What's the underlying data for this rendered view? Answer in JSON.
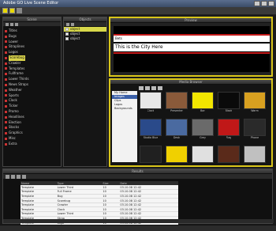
{
  "window": {
    "title": "Adobe GO Live Scene Editor"
  },
  "panels": {
    "tree_title": "Scene",
    "objects_title": "Objects",
    "preview_title": "Preview",
    "media_title": "Media Browser",
    "results_title": "Results"
  },
  "tree": {
    "items": [
      {
        "label": "Titles",
        "hl": false
      },
      {
        "label": "Bugs",
        "hl": false
      },
      {
        "label": "Lower",
        "hl": false
      },
      {
        "label": "Straplines",
        "hl": false
      },
      {
        "label": "Logos",
        "hl": false
      },
      {
        "label": "Scorebug",
        "hl": true
      },
      {
        "label": "Crawler",
        "hl": false
      },
      {
        "label": "Templates",
        "hl": false
      },
      {
        "label": "Fullframe",
        "hl": false
      },
      {
        "label": "Lower Thirds",
        "hl": false
      },
      {
        "label": "News Straps",
        "hl": false
      },
      {
        "label": "Weather",
        "hl": false
      },
      {
        "label": "Sports",
        "hl": false
      },
      {
        "label": "Clock",
        "hl": false
      },
      {
        "label": "Ticker",
        "hl": false
      },
      {
        "label": "Promo",
        "hl": false
      },
      {
        "label": "Headlines",
        "hl": false
      },
      {
        "label": "Election",
        "hl": false
      },
      {
        "label": "Stocks",
        "hl": false
      },
      {
        "label": "Graphics",
        "hl": false
      },
      {
        "label": "Misc",
        "hl": false
      },
      {
        "label": "Extra",
        "hl": false
      }
    ]
  },
  "objects": {
    "items": [
      {
        "label": "object",
        "sel": true
      },
      {
        "label": "object",
        "sel": false
      },
      {
        "label": "object",
        "sel": false
      }
    ]
  },
  "preview": {
    "line1": "Bets",
    "line2": "This is the City Here"
  },
  "media": {
    "folders": [
      {
        "label": "My Home",
        "sel": false
      },
      {
        "label": "Images",
        "sel": true
      },
      {
        "label": "Clips",
        "sel": false
      },
      {
        "label": "Logos",
        "sel": false
      },
      {
        "label": "Backgrounds",
        "sel": false
      }
    ],
    "thumbs": [
      {
        "caption": "Clock",
        "color": "#e8e8e8"
      },
      {
        "caption": "Presenter",
        "color": "#8a5a3a"
      },
      {
        "caption": "Bar",
        "color": "#f2e600"
      },
      {
        "caption": "Black",
        "color": "#0a0a0a"
      },
      {
        "caption": "Warm",
        "color": "#d8a020"
      },
      {
        "caption": "Studio Blue",
        "color": "#2a4a8a"
      },
      {
        "caption": "Desk",
        "color": "#4a6aa0"
      },
      {
        "caption": "Grey",
        "color": "#6a6a6a"
      },
      {
        "caption": "Flag",
        "color": "#c01818"
      },
      {
        "caption": "Phone",
        "color": "#2a2a2a"
      },
      {
        "caption": "",
        "color": "#202020"
      },
      {
        "caption": "",
        "color": "#f0d000"
      },
      {
        "caption": "",
        "color": "#e0e0e0"
      },
      {
        "caption": "",
        "color": "#5a2a1a"
      },
      {
        "caption": "",
        "color": "#c0c0c0"
      }
    ]
  },
  "results": {
    "headers": [
      "Name",
      "Type",
      "Size",
      "Date"
    ],
    "rows": [
      [
        "Template",
        "Lower Third",
        "10",
        "03.10.08 12:42"
      ],
      [
        "Template",
        "Full Frame",
        "10",
        "03.10.08 12:42"
      ],
      [
        "Template",
        "Bug",
        "10",
        "03.10.08 12:42"
      ],
      [
        "Template",
        "Scorebug",
        "10",
        "03.10.08 12:42"
      ],
      [
        "Template",
        "Crawler",
        "10",
        "03.10.08 12:42"
      ],
      [
        "Template",
        "Clock",
        "10",
        "03.10.08 12:42"
      ],
      [
        "Template",
        "Lower Third",
        "10",
        "03.10.08 12:42"
      ],
      [
        "Template",
        "Strap",
        "10",
        "03.10.08 12:42"
      ],
      [
        "Template",
        "Logo",
        "10",
        "03.10.08 12:42"
      ]
    ]
  }
}
